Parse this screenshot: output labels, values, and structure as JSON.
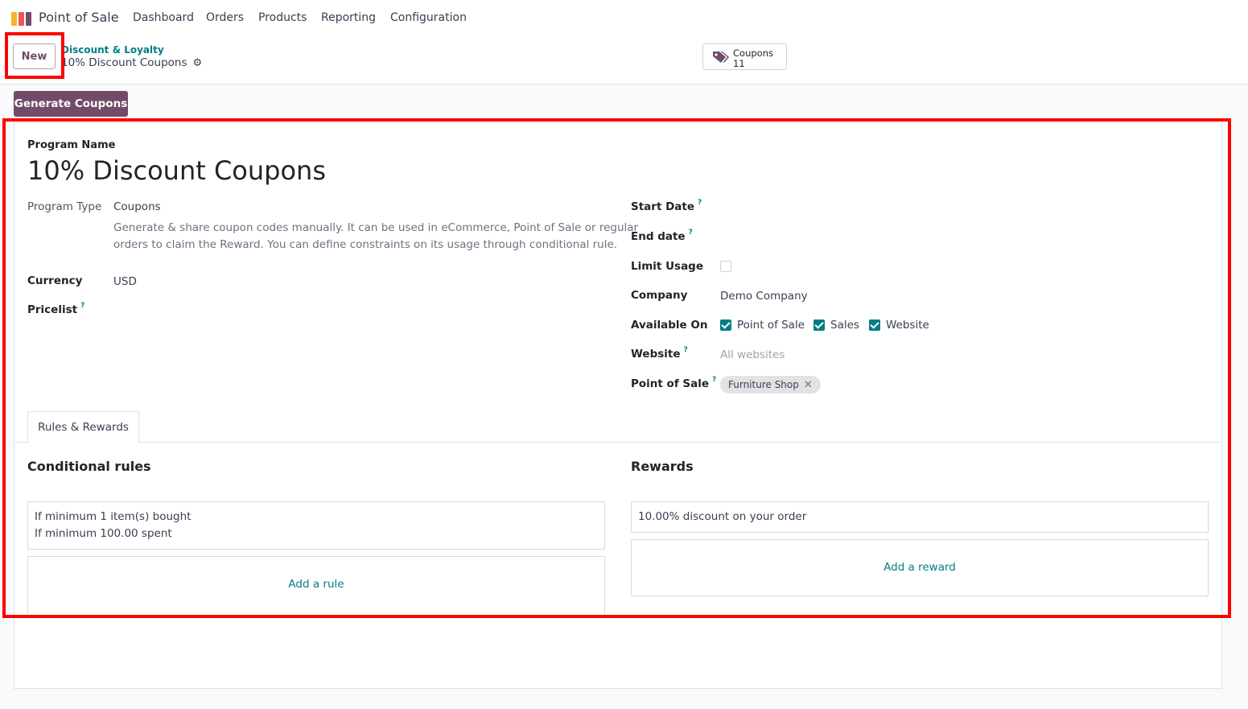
{
  "nav": {
    "app_name": "Point of Sale",
    "menu": [
      "Dashboard",
      "Orders",
      "Products",
      "Reporting",
      "Configuration"
    ]
  },
  "control_panel": {
    "new_label": "New",
    "breadcrumb_parent": "Discount & Loyalty",
    "breadcrumb_current": "10% Discount Coupons",
    "smart_button": {
      "label": "Coupons",
      "count": "11"
    },
    "generate_label": "Generate Coupons"
  },
  "form": {
    "program_name_label": "Program Name",
    "program_name": "10% Discount Coupons",
    "program_type_label": "Program Type",
    "program_type": "Coupons",
    "program_type_help_line1": "Generate & share coupon codes manually. It can be used in eCommerce, Point of Sale or regular",
    "program_type_help_line2": "orders to claim the Reward. You can define constraints on its usage through conditional rule.",
    "currency_label": "Currency",
    "currency": "USD",
    "pricelist_label": "Pricelist",
    "start_date_label": "Start Date",
    "end_date_label": "End date",
    "limit_usage_label": "Limit Usage",
    "company_label": "Company",
    "company": "Demo Company",
    "available_on_label": "Available On",
    "available_on": [
      "Point of Sale",
      "Sales",
      "Website"
    ],
    "website_label": "Website",
    "website_placeholder": "All websites",
    "point_of_sale_label": "Point of Sale",
    "point_of_sale_tag": "Furniture Shop",
    "help_mark": "?"
  },
  "tabs": {
    "rules_rewards": "Rules & Rewards"
  },
  "rules": {
    "title": "Conditional rules",
    "line1": "If minimum 1 item(s) bought",
    "line2": "If minimum 100.00 spent",
    "add_label": "Add a rule"
  },
  "rewards": {
    "title": "Rewards",
    "line1": "10.00% discount on your order",
    "add_label": "Add a reward"
  },
  "colors": {
    "brand": "#714b67",
    "accent": "#017e84",
    "highlight": "#ff0000"
  }
}
